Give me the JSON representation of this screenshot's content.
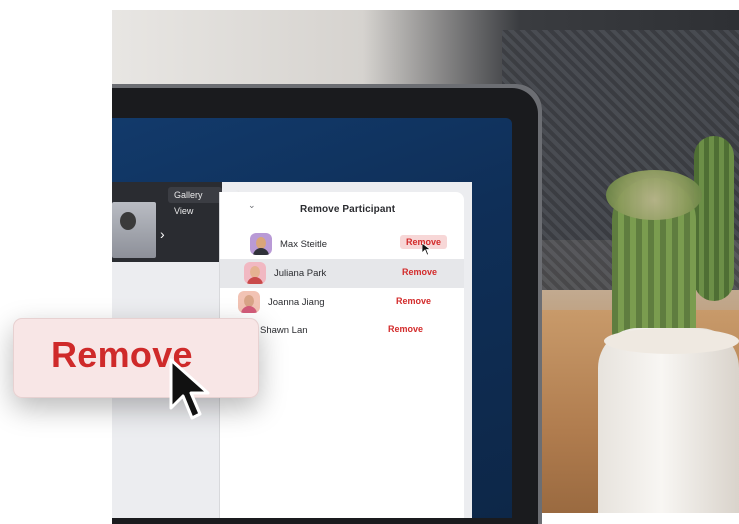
{
  "meeting": {
    "gallery_label": "Gallery View",
    "expand_icon": "expand-icon",
    "chevron_icon": "chevron-right-icon"
  },
  "panel": {
    "title": "Remove Participant",
    "collapse_icon": "chevron-down-icon",
    "participants": [
      {
        "name": "Max Steitle",
        "action": "Remove",
        "state": "hover"
      },
      {
        "name": "Juliana Park",
        "action": "Remove",
        "state": "selected"
      },
      {
        "name": "Joanna Jiang",
        "action": "Remove",
        "state": "normal"
      },
      {
        "name": "Shawn Lan",
        "action": "Remove",
        "state": "normal"
      }
    ]
  },
  "callout": {
    "label": "Remove",
    "cursor_icon": "cursor-arrow-icon"
  },
  "colors": {
    "remove_red": "#cf2a2a",
    "callout_bg": "#f8e6e6",
    "panel_bg": "#ffffff",
    "screen_blue": "#123a6b"
  }
}
